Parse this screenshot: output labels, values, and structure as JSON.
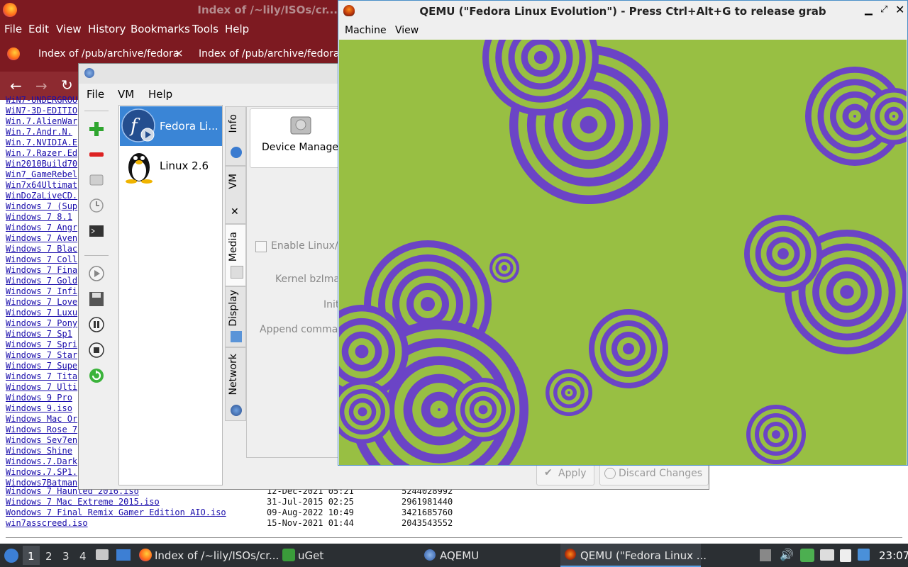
{
  "firefox": {
    "title": "Index of /~lily/ISOs/cr...",
    "menu": [
      "File",
      "Edit",
      "View",
      "History",
      "Bookmarks",
      "Tools",
      "Help"
    ],
    "tabs": [
      "Index of /pub/archive/fedora",
      "Index of /pub/archive/fedora"
    ],
    "listing_left": [
      "WiN7-UNDERGROU",
      "WiN7-3D-EDITIO",
      "Win.7.AlienWar",
      "Win.7.Andr.N.",
      "Win.7.NVIDIA.E",
      "Win.7.Razer.Ed",
      "Win2010Build70",
      "Win7_GameRebel",
      "Win7x64Ultimat",
      "WinDoZaLiveCD.",
      "Windows 7 (Sup",
      "Windows 7 8.1",
      "Windows 7 Angr",
      "Windows 7 Aven",
      "Windows 7 Blac",
      "Windows 7 Coll",
      "Windows 7 Fina",
      "Windows 7 Gold",
      "Windows 7 Infi",
      "Windows 7 Love",
      "Windows 7 Luxu",
      "Windows 7 Pony",
      "Windows 7 Sp1",
      "Windows 7 Spri",
      "Windows 7 Star",
      "Windows 7 Supe",
      "Windows 7 Tita",
      "Windows 7 Ulti",
      "Windows 9 Pro",
      "Windows 9.iso",
      "Windows Mac Or",
      "Windows Rose 7",
      "Windows Sev7en",
      "Windows Shine",
      "Windows.7.Dark",
      "Windows.7.SP1.",
      "Windows7Batman"
    ],
    "listing_full": [
      {
        "name": "Windows 7 Haunted 2016.iso",
        "date": "12-Dec-2021 05:21",
        "size": "5244028992"
      },
      {
        "name": "Windows 7 Mac Extreme 2015.iso",
        "date": "31-Jul-2015 02:25",
        "size": "2961981440"
      },
      {
        "name": "Wondows 7 Final Remix Gamer Edition AIO.iso",
        "date": "09-Aug-2022 10:49",
        "size": "3421685760"
      },
      {
        "name": "win7asscreed.iso",
        "date": "15-Nov-2021 01:44",
        "size": "2043543552"
      }
    ]
  },
  "aqemu": {
    "menu": [
      "File",
      "VM",
      "Help"
    ],
    "vms": [
      {
        "label": "Fedora Li..."
      },
      {
        "label": "Linux 2.6"
      }
    ],
    "tabs": [
      "Info",
      "VM",
      "Media",
      "Display",
      "Network"
    ],
    "device_manager": "Device Manager",
    "enable_boot": "Enable Linux/M",
    "kernel": "Kernel bzImag",
    "initrd": "Init",
    "append": "Append comman",
    "apply": "Apply",
    "discard": "Discard Changes"
  },
  "qemu": {
    "title": "QEMU (\"Fedora Linux Evolution\") - Press Ctrl+Alt+G to release grab",
    "menu": [
      "Machine",
      "View"
    ],
    "colors": {
      "background": "#98bf43",
      "rings": "#6b44c6"
    }
  },
  "taskbar": {
    "workspaces": [
      "1",
      "2",
      "3",
      "4"
    ],
    "tasks": [
      "Index of /~lily/ISOs/cr...",
      "uGet",
      "AQEMU",
      "QEMU (\"Fedora Linux ..."
    ],
    "clock": "23:07"
  }
}
